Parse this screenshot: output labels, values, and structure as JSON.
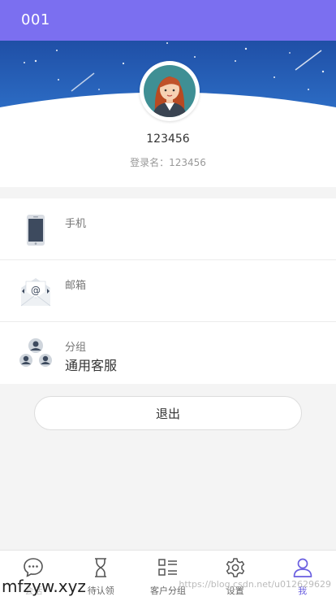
{
  "header": {
    "title": "001"
  },
  "profile": {
    "username": "123456",
    "login_name": "登录名：123456"
  },
  "info": [
    {
      "label": "手机",
      "value": "",
      "icon": "phone-icon"
    },
    {
      "label": "邮箱",
      "value": "",
      "icon": "mail-icon"
    },
    {
      "label": "分组",
      "value": "通用客服",
      "icon": "group-icon"
    }
  ],
  "logout_label": "退出",
  "tabs": [
    {
      "label": "会话",
      "icon": "chat-icon"
    },
    {
      "label": "待认领",
      "icon": "hourglass-icon"
    },
    {
      "label": "客户分组",
      "icon": "list-icon"
    },
    {
      "label": "设置",
      "icon": "gear-icon"
    },
    {
      "label": "我",
      "icon": "person-icon",
      "active": true
    }
  ],
  "watermark": {
    "site": "mfzyw.xyz",
    "blog": "https://blog.csdn.net/u012629629"
  },
  "colors": {
    "header": "#7b6ff0",
    "sky_top": "#1e4fa8",
    "sky_bottom": "#3a8ee8",
    "active_tab": "#6a5fe0"
  }
}
